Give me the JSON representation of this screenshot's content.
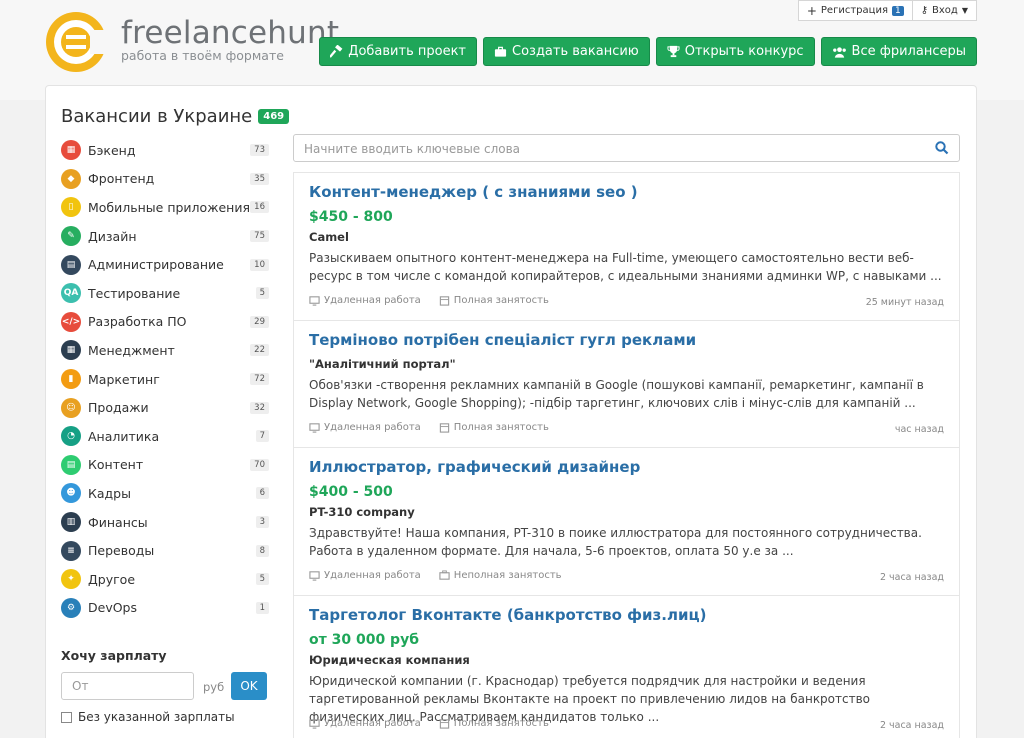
{
  "brand": {
    "name": "freelancehunt",
    "tagline": "работа в твоём формате"
  },
  "auth": {
    "register_label": "Регистрация",
    "register_count": "1",
    "login_label": "Вход"
  },
  "actions": [
    {
      "label": "Добавить проект",
      "icon": "hammer-icon"
    },
    {
      "label": "Создать вакансию",
      "icon": "briefcase-icon"
    },
    {
      "label": "Открыть конкурс",
      "icon": "trophy-icon"
    },
    {
      "label": "Все фрилансеры",
      "icon": "users-icon"
    }
  ],
  "page": {
    "title": "Вакансии в Украине",
    "count": "469"
  },
  "categories": [
    {
      "label": "Бэкенд",
      "count": "73",
      "color": "#e74c3c"
    },
    {
      "label": "Фронтенд",
      "count": "35",
      "color": "#e8a021"
    },
    {
      "label": "Мобильные приложения",
      "count": "16",
      "color": "#f1c40f"
    },
    {
      "label": "Дизайн",
      "count": "75",
      "color": "#27ae60"
    },
    {
      "label": "Администрирование",
      "count": "10",
      "color": "#34495e"
    },
    {
      "label": "Тестирование",
      "count": "5",
      "color": "#3cbfae"
    },
    {
      "label": "Разработка ПО",
      "count": "29",
      "color": "#e74c3c"
    },
    {
      "label": "Менеджмент",
      "count": "22",
      "color": "#2c3e50"
    },
    {
      "label": "Маркетинг",
      "count": "72",
      "color": "#f39c12"
    },
    {
      "label": "Продажи",
      "count": "32",
      "color": "#e8a021"
    },
    {
      "label": "Аналитика",
      "count": "7",
      "color": "#16a085"
    },
    {
      "label": "Контент",
      "count": "70",
      "color": "#2ecc71"
    },
    {
      "label": "Кадры",
      "count": "6",
      "color": "#3498db"
    },
    {
      "label": "Финансы",
      "count": "3",
      "color": "#2c3e50"
    },
    {
      "label": "Переводы",
      "count": "8",
      "color": "#34495e"
    },
    {
      "label": "Другое",
      "count": "5",
      "color": "#f1c40f"
    },
    {
      "label": "DevOps",
      "count": "1",
      "color": "#2980b9"
    }
  ],
  "salary": {
    "title": "Хочу зарплату",
    "placeholder": "От",
    "currency": "руб",
    "ok_label": "OK",
    "no_salary_label": "Без указанной зарплаты"
  },
  "search": {
    "placeholder": "Начните вводить ключевые слова"
  },
  "jobs": [
    {
      "title": "Контент-менеджер ( с знаниями seo )",
      "price": "$450 - 800",
      "company": "Camel",
      "desc": "Разыскиваем опытного контент-менеджера на Full-time, умеющего самостоятельно вести веб-ресурс в том числе с командой копирайтеров, с идеальными знаниями админки WP, с навыками ...",
      "remote": "Удаленная работа",
      "employment": "Полная занятость",
      "time": "25 минут назад"
    },
    {
      "title": "Терміново потрібен спеціаліст гугл реклами",
      "price": "",
      "company": "\"Аналітичний портал\"",
      "desc": "Обов'язки -створення рекламних кампаній в Google (пошукові кампанії, ремаркетинг, кампанії в Display Network, Google Shopping); -підбір таргетинг, ключових слів і мінус-слів для кампаній ...",
      "remote": "Удаленная работа",
      "employment": "Полная занятость",
      "time": "час назад"
    },
    {
      "title": "Иллюстратор, графический дизайнер",
      "price": "$400 - 500",
      "company": "PT-310 company",
      "desc": "Здравствуйте! Наша компания, PT-310 в поике иллюстратора для постоянного сотрудничества. Работа в удаленном формате. Для начала, 5-6 проектов, оплата 50 у.е за ...",
      "remote": "Удаленная работа",
      "employment": "Неполная занятость",
      "time": "2 часа назад"
    },
    {
      "title": "Таргетолог Вконтакте (банкротство физ.лиц)",
      "price": "от 30 000 руб",
      "company": "Юридическая компания",
      "desc": "Юридической компании (г. Краснодар) требуется подрядчик для настройки и ведения таргетированной рекламы Вконтакте на проект по привлечению лидов на банкротство физических лиц. Рассматриваем кандидатов только ...",
      "remote": "Удаленная работа",
      "employment": "Полная занятость",
      "time": "2 часа назад"
    }
  ]
}
